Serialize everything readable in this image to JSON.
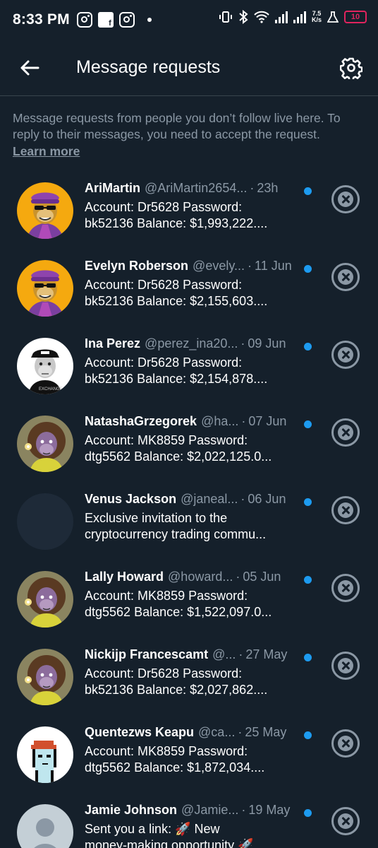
{
  "status_bar": {
    "time": "8:33 PM",
    "net_speed_value": "7.5",
    "net_speed_unit": "K/s",
    "battery": "10",
    "icons": [
      "instagram-icon",
      "contact-card-icon",
      "instagram-icon",
      "dot-icon",
      "vibrate-icon",
      "bluetooth-icon",
      "wifi-icon",
      "signal-icon",
      "signal-icon",
      "alert-icon",
      "battery-icon"
    ]
  },
  "header": {
    "title": "Message requests",
    "back_icon": "arrow-left-icon",
    "settings_icon": "gear-icon"
  },
  "info": {
    "text": "Message requests from people you don’t follow live here. To reply to their messages, you need to accept the request.",
    "link": "Learn more"
  },
  "colors": {
    "background": "#15202b",
    "secondary_text": "#8b98a5",
    "unread_dot": "#1d9bf0",
    "divider": "#38444d"
  },
  "requests": [
    {
      "name": "AriMartin",
      "handle": "@AriMartin2654...",
      "sep": "·",
      "date": "23h",
      "line1": "Account: Dr5628 Password:",
      "line2": "bk52136  Balance: $1,993,222....",
      "avatar": "ape-purple-hat"
    },
    {
      "name": "Evelyn Roberson",
      "handle": "@evely...",
      "sep": "·",
      "date": "11 Jun",
      "line1": "Account: Dr5628 Password:",
      "line2": "bk52136  Balance: $2,155,603....",
      "avatar": "ape-purple-hat"
    },
    {
      "name": "Ina Perez",
      "handle": "@perez_ina20...",
      "sep": "·",
      "date": "09 Jun",
      "line1": "Account: Dr5628 Password:",
      "line2": "bk52136  Balance: $2,154,878....",
      "avatar": "ape-black-cap"
    },
    {
      "name": "NatashaGrzegorek",
      "handle": "@ha...",
      "sep": "·",
      "date": "07 Jun",
      "line1": "Account: MK8859 Password:",
      "line2": "dtg5562 Balance: $2,022,125.0...",
      "avatar": "ape-lion-mane"
    },
    {
      "name": "Venus Jackson",
      "handle": "@janeal...",
      "sep": "·",
      "date": "06 Jun",
      "line1": "Exclusive invitation to the",
      "line2": "cryptocurrency trading commu...",
      "avatar": "blank"
    },
    {
      "name": "Lally Howard",
      "handle": "@howard...",
      "sep": "·",
      "date": "05 Jun",
      "line1": "Account: MK8859 Password:",
      "line2": "dtg5562 Balance: $1,522,097.0...",
      "avatar": "ape-lion-mane"
    },
    {
      "name": "Nickijp Francescamt",
      "handle": "@...",
      "sep": "·",
      "date": "27 May",
      "line1": "Account: Dr5628 Password:",
      "line2": "bk52136  Balance: $2,027,862....",
      "avatar": "ape-lion-mane"
    },
    {
      "name": "Quentezws Keapu",
      "handle": "@ca...",
      "sep": "·",
      "date": "25 May",
      "line1": "Account: MK8859 Password:",
      "line2": "dtg5562 Balance: $1,872,034....",
      "avatar": "pixel-punk"
    },
    {
      "name": "Jamie Johnson",
      "handle": "@Jamie...",
      "sep": "·",
      "date": "19 May",
      "line1": "Sent you a link: 🚀 New",
      "line2": "money-making opportunity 🚀",
      "avatar": "default-person"
    }
  ]
}
